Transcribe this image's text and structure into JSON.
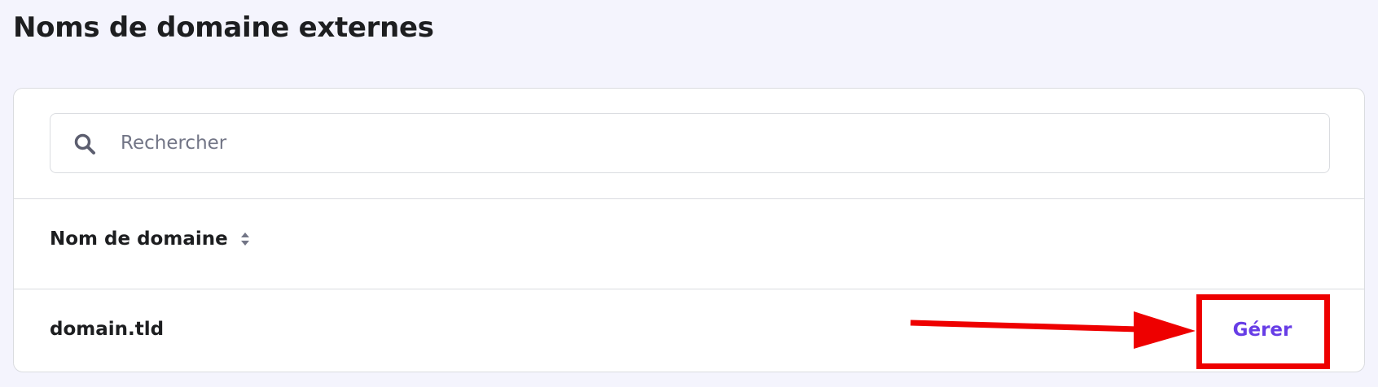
{
  "page": {
    "title": "Noms de domaine externes"
  },
  "search": {
    "placeholder": "Rechercher",
    "value": "",
    "icon": "search-icon"
  },
  "table": {
    "columns": [
      {
        "label": "Nom de domaine",
        "sort_icon": "sort-icon"
      }
    ],
    "rows": [
      {
        "domain": "domain.tld",
        "action_label": "Gérer"
      }
    ]
  },
  "colors": {
    "background": "#f4f4fd",
    "accent": "#673de6",
    "annotation": "#ee0000",
    "border": "#dadce0"
  }
}
